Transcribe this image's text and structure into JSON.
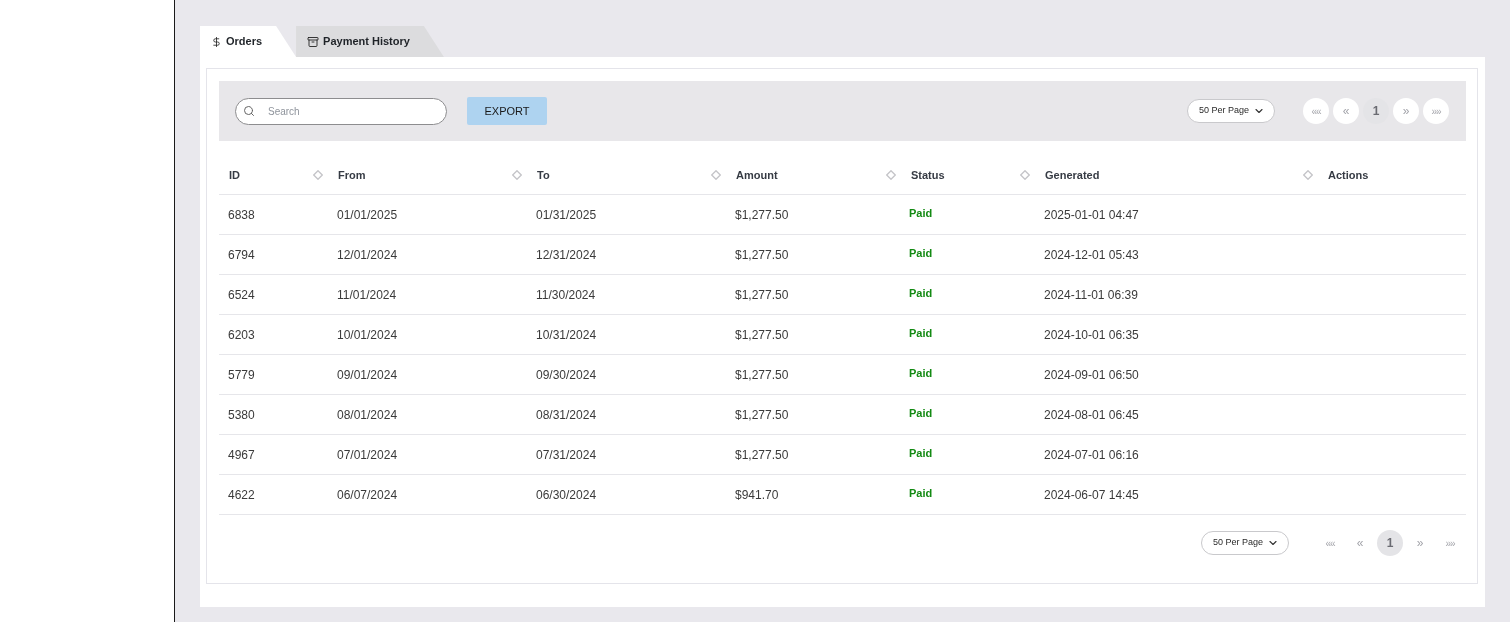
{
  "tabs": [
    {
      "label": "Orders",
      "selected": true
    },
    {
      "label": "Payment History",
      "selected": false
    }
  ],
  "toolbar": {
    "search": {
      "placeholder": "Search"
    },
    "export_button": "EXPORT",
    "pagination": {
      "per_page": "50 Per Page",
      "buttons": [
        {
          "kind": "first",
          "label": "««",
          "selected": false,
          "disabled": true
        },
        {
          "kind": "previous",
          "label": "«",
          "selected": false,
          "disabled": true
        },
        {
          "kind": "page",
          "label": "1",
          "selected": true,
          "disabled": false
        },
        {
          "kind": "next",
          "label": "»",
          "selected": false,
          "disabled": true
        },
        {
          "kind": "last",
          "label": "»»",
          "selected": false,
          "disabled": true
        }
      ]
    }
  },
  "table": {
    "columns": [
      {
        "label": "ID",
        "sortable": true
      },
      {
        "label": "From",
        "sortable": true
      },
      {
        "label": "To",
        "sortable": true
      },
      {
        "label": "Amount",
        "sortable": true
      },
      {
        "label": "Status",
        "sortable": true
      },
      {
        "label": "Generated",
        "sortable": true
      },
      {
        "label": "Actions",
        "sortable": false
      }
    ],
    "rows": [
      {
        "id": "6838",
        "from": "01/01/2025",
        "to": "01/31/2025",
        "amount": "$1,277.50",
        "status": "Paid",
        "generated": "2025-01-01 04:47"
      },
      {
        "id": "6794",
        "from": "12/01/2024",
        "to": "12/31/2024",
        "amount": "$1,277.50",
        "status": "Paid",
        "generated": "2024-12-01 05:43"
      },
      {
        "id": "6524",
        "from": "11/01/2024",
        "to": "11/30/2024",
        "amount": "$1,277.50",
        "status": "Paid",
        "generated": "2024-11-01 06:39"
      },
      {
        "id": "6203",
        "from": "10/01/2024",
        "to": "10/31/2024",
        "amount": "$1,277.50",
        "status": "Paid",
        "generated": "2024-10-01 06:35"
      },
      {
        "id": "5779",
        "from": "09/01/2024",
        "to": "09/30/2024",
        "amount": "$1,277.50",
        "status": "Paid",
        "generated": "2024-09-01 06:50"
      },
      {
        "id": "5380",
        "from": "08/01/2024",
        "to": "08/31/2024",
        "amount": "$1,277.50",
        "status": "Paid",
        "generated": "2024-08-01 06:45"
      },
      {
        "id": "4967",
        "from": "07/01/2024",
        "to": "07/31/2024",
        "amount": "$1,277.50",
        "status": "Paid",
        "generated": "2024-07-01 06:16"
      },
      {
        "id": "4622",
        "from": "06/07/2024",
        "to": "06/30/2024",
        "amount": "$941.70",
        "status": "Paid",
        "generated": "2024-06-07 14:45"
      }
    ]
  },
  "footer_pagination": {
    "per_page": "50 Per Page",
    "buttons": [
      {
        "kind": "first",
        "label": "««",
        "selected": false,
        "disabled": true
      },
      {
        "kind": "previous",
        "label": "«",
        "selected": false,
        "disabled": true
      },
      {
        "kind": "page",
        "label": "1",
        "selected": true,
        "disabled": false
      },
      {
        "kind": "next",
        "label": "»",
        "selected": false,
        "disabled": true
      },
      {
        "kind": "last",
        "label": "»»",
        "selected": false,
        "disabled": true
      }
    ]
  }
}
